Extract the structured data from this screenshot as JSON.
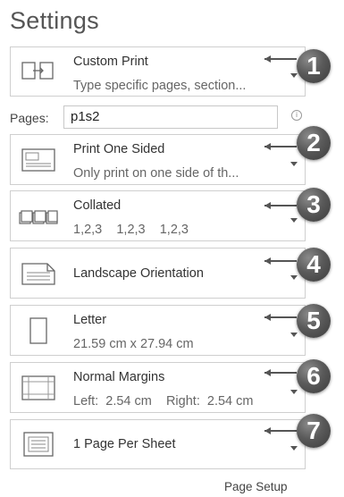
{
  "section_title": "Settings",
  "pages": {
    "label": "Pages:",
    "value": "p1s2",
    "info_icon": "i"
  },
  "settings": [
    {
      "title": "Custom Print",
      "subtitle": "Type specific pages, section...",
      "badge": "1"
    },
    {
      "title": "Print One Sided",
      "subtitle": "Only print on one side of th...",
      "badge": "2"
    },
    {
      "title": "Collated",
      "subtitle": "1,2,3    1,2,3    1,2,3",
      "badge": "3"
    },
    {
      "title": "Landscape Orientation",
      "badge": "4"
    },
    {
      "title": "Letter",
      "subtitle": "21.59 cm x 27.94 cm",
      "badge": "5"
    },
    {
      "title": "Normal Margins",
      "subtitle": "Left:  2.54 cm    Right:  2.54 cm",
      "badge": "6"
    },
    {
      "title": "1 Page Per Sheet",
      "badge": "7"
    }
  ],
  "page_setup_link": "Page Setup"
}
